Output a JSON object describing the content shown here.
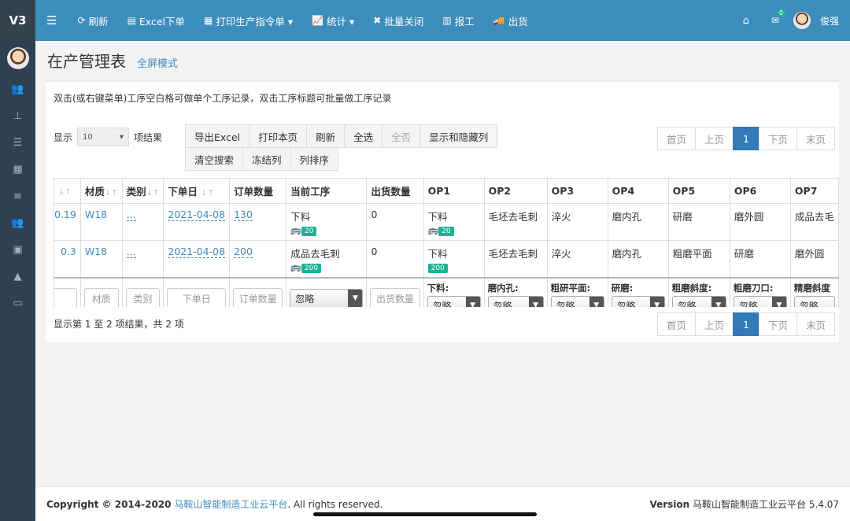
{
  "topbar": {
    "logo": "V3",
    "menu_icon": "☰",
    "items": [
      {
        "icon": "⟳",
        "label": "刷新"
      },
      {
        "icon": "▤",
        "label": "Excel下单"
      },
      {
        "icon": "▦",
        "label": "打印生产指令单 ▾"
      },
      {
        "icon": "📈",
        "label": "统计 ▾"
      },
      {
        "icon": "✖",
        "label": "批量关闭"
      },
      {
        "icon": "▥",
        "label": "报工"
      },
      {
        "icon": "🚚",
        "label": "出货"
      }
    ],
    "mail_badge": "0",
    "user_name": "俊强"
  },
  "sidebar_icons": [
    "users-icon",
    "sitemap-icon",
    "database-icon",
    "qrcode-icon",
    "list-icon",
    "group-icon",
    "calendar-icon",
    "chart-icon",
    "monitor-icon"
  ],
  "page": {
    "title": "在产管理表",
    "fullscreen_link": "全屏模式"
  },
  "hint": "双击(或右键菜单)工序空白格可做单个工序记录，双击工序标题可批量做工序记录",
  "length_control": {
    "prefix": "显示",
    "value": "10",
    "suffix": "项结果"
  },
  "toolbar_buttons": [
    "导出Excel",
    "打印本页",
    "刷新",
    "全选",
    "全否",
    "显示和隐藏列",
    "清空搜索",
    "冻结列",
    "列排序"
  ],
  "pagination": {
    "first": "首页",
    "prev": "上页",
    "current": "1",
    "next": "下页",
    "last": "末页"
  },
  "table": {
    "headers": [
      "",
      "材质",
      "类别",
      "下单日",
      "订单数量",
      "当前工序",
      "出货数量",
      "OP1",
      "OP2",
      "OP3",
      "OP4",
      "OP5",
      "OP6",
      "OP7"
    ],
    "rows": [
      {
        "id": "0.19",
        "material": "W18",
        "category": "...",
        "date": "2021-04-08",
        "qty": "130",
        "current": "下料",
        "current_badge": "20",
        "shipped": "0",
        "op1": "下料",
        "op1_badge": "20",
        "op2": "毛坯去毛刺",
        "op3": "淬火",
        "op4": "磨内孔",
        "op5": "研磨",
        "op6": "磨外圆",
        "op7": "成品去毛"
      },
      {
        "id": "0.3",
        "material": "W18",
        "category": "...",
        "date": "2021-04-08",
        "qty": "200",
        "current": "成品去毛刺",
        "current_badge": "200",
        "shipped": "0",
        "op1": "下料",
        "op1_badge": "200",
        "op2": "毛坯去毛刺",
        "op3": "淬火",
        "op4": "磨内孔",
        "op5": "粗磨平面",
        "op6": "研磨",
        "op7": "磨外圆"
      }
    ],
    "filters": {
      "material": "材质",
      "category": "类别",
      "date": "下单日",
      "qty": "订单数量",
      "current": "忽略",
      "shipped": "出货数量",
      "ops": [
        {
          "label": "下料:",
          "value": "忽略"
        },
        {
          "label": "磨内孔:",
          "value": "忽略"
        },
        {
          "label": "粗研平面:",
          "value": "忽略"
        },
        {
          "label": "研磨:",
          "value": "忽略"
        },
        {
          "label": "粗磨斜度:",
          "value": "忽略"
        },
        {
          "label": "粗磨刀口:",
          "value": "忽略"
        },
        {
          "label": "精磨斜度",
          "value": "忽略"
        }
      ]
    }
  },
  "summary": "显示第 1 至 2 项结果，共 2 项",
  "footer": {
    "copyright_prefix": "Copyright © 2014-2020",
    "company": "马鞍山智能制造工业云平台",
    "rights": ". All rights reserved.",
    "version_label": "Version",
    "version_text": "马鞍山智能制造工业云平台 5.4.07"
  },
  "colors": {
    "topbar": "#3c8dbc",
    "sidebar": "#2f4050",
    "badge": "#1ab394",
    "active_page": "#337ab7"
  }
}
